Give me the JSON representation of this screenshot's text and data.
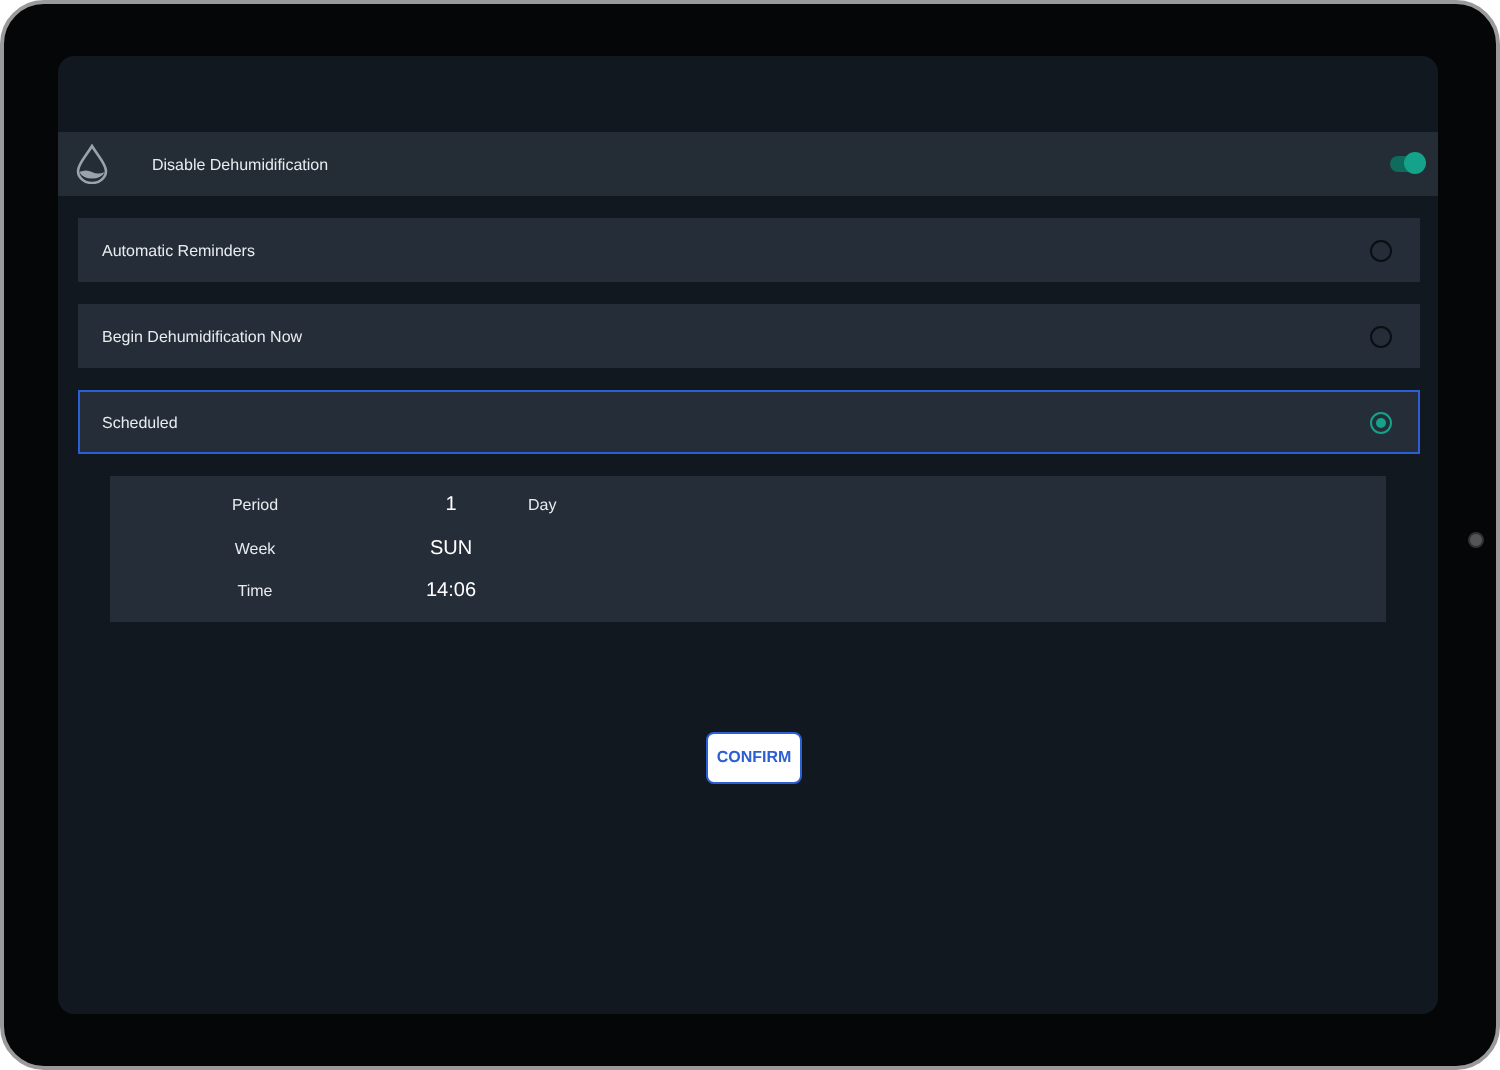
{
  "header": {
    "title": "Disable Dehumidification",
    "on": true
  },
  "options": [
    {
      "label": "Automatic Reminders",
      "selected": false
    },
    {
      "label": "Begin Dehumidification Now",
      "selected": false
    },
    {
      "label": "Scheduled",
      "selected": true
    }
  ],
  "schedule": [
    {
      "label": "Period",
      "value": "1",
      "unit": "Day"
    },
    {
      "label": "Week",
      "value": "SUN"
    },
    {
      "label": "Time",
      "value": "14:06"
    }
  ],
  "confirm": "CONFIRM"
}
